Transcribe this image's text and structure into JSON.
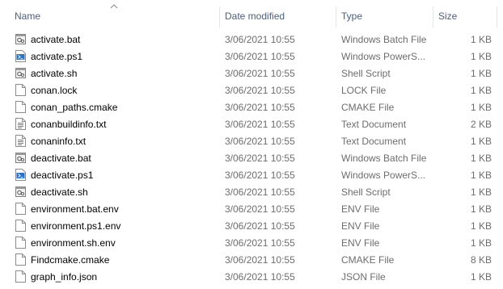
{
  "columns": {
    "name": "Name",
    "date_modified": "Date modified",
    "type": "Type",
    "size": "Size"
  },
  "files": [
    {
      "name": "activate.bat",
      "date": "3/06/2021 10:55",
      "type": "Windows Batch File",
      "size": "1 KB",
      "icon": "batch-file-icon"
    },
    {
      "name": "activate.ps1",
      "date": "3/06/2021 10:55",
      "type": "Windows PowerS...",
      "size": "1 KB",
      "icon": "powershell-file-icon"
    },
    {
      "name": "activate.sh",
      "date": "3/06/2021 10:55",
      "type": "Shell Script",
      "size": "1 KB",
      "icon": "shell-script-icon"
    },
    {
      "name": "conan.lock",
      "date": "3/06/2021 10:55",
      "type": "LOCK File",
      "size": "1 KB",
      "icon": "blank-file-icon"
    },
    {
      "name": "conan_paths.cmake",
      "date": "3/06/2021 10:55",
      "type": "CMAKE File",
      "size": "1 KB",
      "icon": "blank-file-icon"
    },
    {
      "name": "conanbuildinfo.txt",
      "date": "3/06/2021 10:55",
      "type": "Text Document",
      "size": "2 KB",
      "icon": "text-file-icon"
    },
    {
      "name": "conaninfo.txt",
      "date": "3/06/2021 10:55",
      "type": "Text Document",
      "size": "1 KB",
      "icon": "text-file-icon"
    },
    {
      "name": "deactivate.bat",
      "date": "3/06/2021 10:55",
      "type": "Windows Batch File",
      "size": "1 KB",
      "icon": "batch-file-icon"
    },
    {
      "name": "deactivate.ps1",
      "date": "3/06/2021 10:55",
      "type": "Windows PowerS...",
      "size": "1 KB",
      "icon": "powershell-file-icon"
    },
    {
      "name": "deactivate.sh",
      "date": "3/06/2021 10:55",
      "type": "Shell Script",
      "size": "1 KB",
      "icon": "shell-script-icon"
    },
    {
      "name": "environment.bat.env",
      "date": "3/06/2021 10:55",
      "type": "ENV File",
      "size": "1 KB",
      "icon": "blank-file-icon"
    },
    {
      "name": "environment.ps1.env",
      "date": "3/06/2021 10:55",
      "type": "ENV File",
      "size": "1 KB",
      "icon": "blank-file-icon"
    },
    {
      "name": "environment.sh.env",
      "date": "3/06/2021 10:55",
      "type": "ENV File",
      "size": "1 KB",
      "icon": "blank-file-icon"
    },
    {
      "name": "Findcmake.cmake",
      "date": "3/06/2021 10:55",
      "type": "CMAKE File",
      "size": "8 KB",
      "icon": "blank-file-icon"
    },
    {
      "name": "graph_info.json",
      "date": "3/06/2021 10:55",
      "type": "JSON File",
      "size": "1 KB",
      "icon": "blank-file-icon"
    }
  ]
}
